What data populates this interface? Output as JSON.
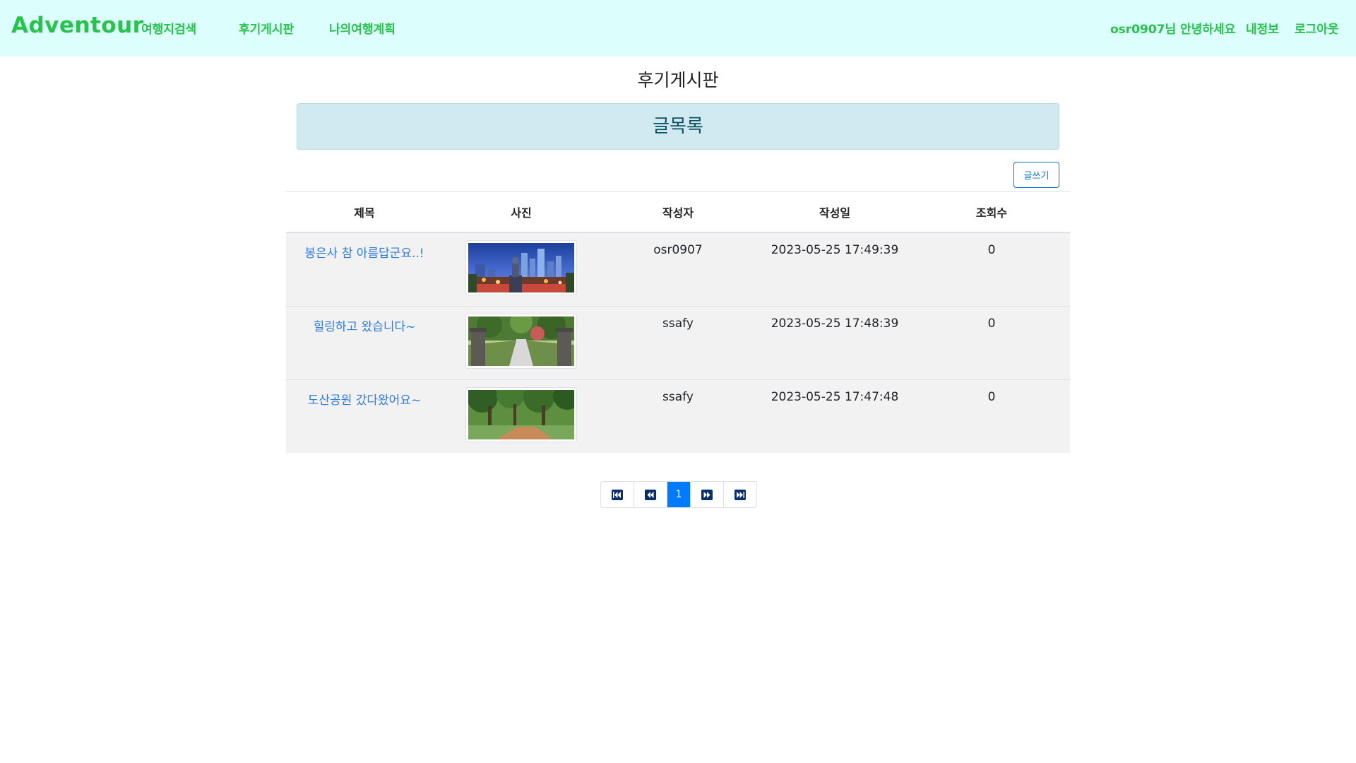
{
  "nav": {
    "brand": "Adventour",
    "links": [
      "여행지검색",
      "후기게시판",
      "나의여행계획"
    ],
    "greeting": "osr0907님 안녕하세요",
    "my_info": "내정보",
    "logout": "로그아웃"
  },
  "page": {
    "title": "후기게시판",
    "banner": "글목록",
    "write_label": "글쓰기"
  },
  "table": {
    "headers": [
      "제목",
      "사진",
      "작성자",
      "작성일",
      "조회수"
    ],
    "rows": [
      {
        "title": "봉은사 참 아름답군요..!",
        "author": "osr0907",
        "date": "2023-05-25 17:49:39",
        "views": "0",
        "photo": "temple-night-cityscape"
      },
      {
        "title": "힐링하고 왔습니다~",
        "author": "ssafy",
        "date": "2023-05-25 17:48:39",
        "views": "0",
        "photo": "park-path-stone-gate"
      },
      {
        "title": "도산공원 갔다왔어요~",
        "author": "ssafy",
        "date": "2023-05-25 17:47:48",
        "views": "0",
        "photo": "park-trees-walkway"
      }
    ]
  },
  "pagination": {
    "current": "1",
    "icons": [
      "first-page-icon",
      "prev-page-icon",
      "next-page-icon",
      "last-page-icon"
    ]
  },
  "colors": {
    "navbar_bg": "#dcfefd",
    "brand_green": "#27c44b",
    "link_blue": "#2f7de1",
    "active_page": "#007bff",
    "banner_bg": "#d1e9f0"
  }
}
